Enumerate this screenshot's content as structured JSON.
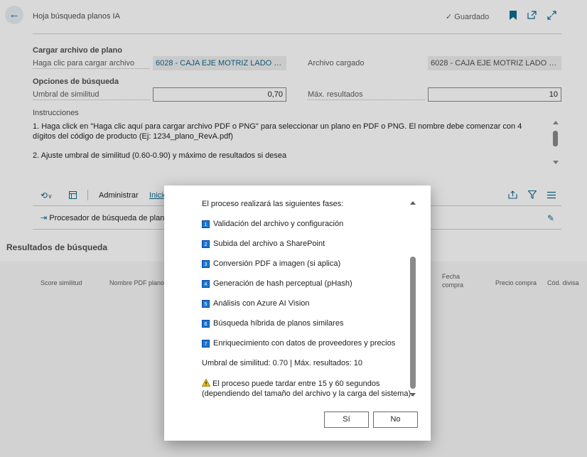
{
  "header": {
    "title": "Hoja búsqueda planos IA",
    "saved_label": "Guardado"
  },
  "upload": {
    "section_title": "Cargar archivo de plano",
    "click_label": "Haga clic para cargar archivo",
    "click_value": "6028 - CAJA EJE MOTRIZ LADO CON...",
    "loaded_label": "Archivo cargado",
    "loaded_value": "6028 - CAJA EJE MOTRIZ LADO CON..."
  },
  "search_options": {
    "section_title": "Opciones de búsqueda",
    "threshold_label": "Umbral de similitud",
    "threshold_value": "0,70",
    "max_label": "Máx. resultados",
    "max_value": "10"
  },
  "instructions": {
    "title": "Instrucciones",
    "line1": "1. Haga click en \"Haga clic aquí para cargar archivo PDF o PNG\" para seleccionar un plano en PDF o PNG. El nombre debe comenzar con 4 dígitos del código de producto (Ej: 1234_plano_RevA.pdf)",
    "line2": "2. Ajuste umbral de similitud (0.60-0.90) y máximo de resultados si desea"
  },
  "actionbar": {
    "administrar": "Administrar",
    "inicio": "Inicio",
    "processor": "Procesador de búsqueda de plano"
  },
  "results": {
    "title": "Resultados de búsqueda",
    "columns": [
      "Score similitud",
      "Nombre PDF plano",
      "Fecha compra",
      "Precio compra",
      "Cód. divisa"
    ]
  },
  "dialog": {
    "intro": "El proceso realizará las siguientes fases:",
    "phases": [
      {
        "n": "1",
        "text": "Validación del archivo y configuración"
      },
      {
        "n": "2",
        "text": "Subida del archivo a SharePoint"
      },
      {
        "n": "3",
        "text": "Conversión PDF a imagen (si aplica)"
      },
      {
        "n": "4",
        "text": "Generación de hash perceptual (pHash)"
      },
      {
        "n": "5",
        "text": "Análisis con Azure AI Vision"
      },
      {
        "n": "6",
        "text": "Búsqueda híbrida de planos similares"
      },
      {
        "n": "7",
        "text": "Enriquecimiento con datos de proveedores y precios"
      }
    ],
    "summary": "Umbral de similitud: 0.70 | Máx. resultados: 10",
    "warning_line1": "El proceso puede tardar entre 15 y 60 segundos",
    "warning_line2": "(dependiendo del tamaño del archivo y la carga del sistema).",
    "yes": "Sí",
    "no": "No"
  }
}
